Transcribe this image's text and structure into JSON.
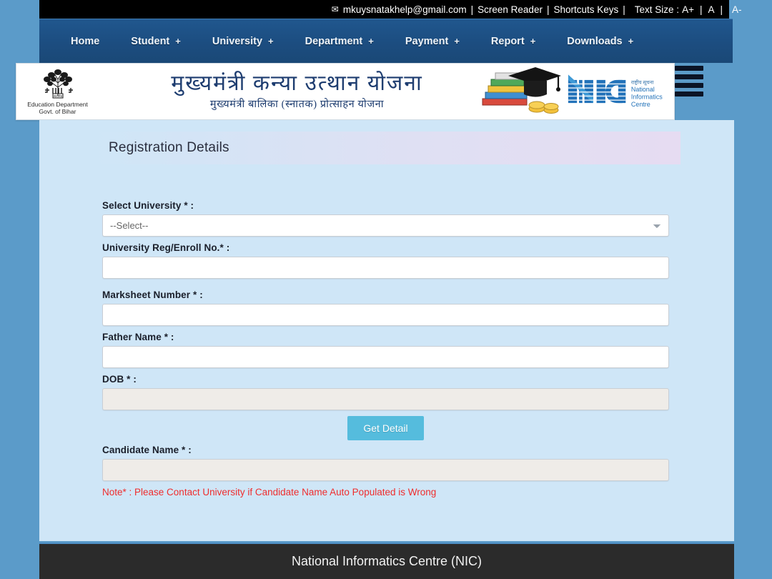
{
  "topbar": {
    "mail_icon": "envelope-icon",
    "email": "mkuysnatakhelp@gmail.com",
    "sep1": "|",
    "screen_reader": "Screen Reader",
    "sep2": "|",
    "shortcuts": "Shortcuts Keys",
    "sep3": "|",
    "text_size_label": "Text Size :",
    "a_plus": "A+",
    "sep4": "|",
    "a_normal": "A",
    "sep5": "|",
    "a_minus": "A-"
  },
  "nav": {
    "items": [
      {
        "label": "Home",
        "plus": ""
      },
      {
        "label": "Student",
        "plus": "+"
      },
      {
        "label": "University",
        "plus": "+"
      },
      {
        "label": "Department",
        "plus": "+"
      },
      {
        "label": "Payment",
        "plus": "+"
      },
      {
        "label": "Report",
        "plus": "+"
      },
      {
        "label": "Downloads",
        "plus": "+"
      }
    ]
  },
  "banner": {
    "emblem_line1": "Education Department",
    "emblem_line2": "Govt. of Bihar",
    "title_hi": "मुख्यमंत्री कन्या उत्थान योजना",
    "subtitle_hi": "मुख्यमंत्री बालिका (स्नातक) प्रोत्साहन योजना",
    "nic_abbr": "NIC",
    "nic_hi": "राष्ट्रीय सूचना विज्ञान केन्द्र",
    "nic_l1": "National",
    "nic_l2": "Informatics",
    "nic_l3": "Centre",
    "menu_icon": "hamburger-menu-icon"
  },
  "panel": {
    "title": "Registration Details"
  },
  "form": {
    "university": {
      "label": "Select University * :",
      "selected": "--Select--",
      "options": [
        "--Select--"
      ]
    },
    "reg_no": {
      "label": "University Reg/Enroll No.* :",
      "value": "",
      "placeholder": ""
    },
    "marksheet": {
      "label": "Marksheet Number * :",
      "value": "",
      "placeholder": ""
    },
    "father_name": {
      "label": "Father Name * :",
      "value": "",
      "placeholder": ""
    },
    "dob": {
      "label": "DOB * :",
      "value": "",
      "placeholder": ""
    },
    "get_detail_button": "Get Detail",
    "candidate_name": {
      "label": "Candidate Name * :",
      "value": "",
      "placeholder": ""
    },
    "note": "Note* : Please Contact University if Candidate Name Auto Populated is Wrong"
  },
  "footer": {
    "text": "National Informatics Centre (NIC)"
  },
  "colors": {
    "page_bg": "#5b9bc9",
    "nav_bg": "#1c4d80",
    "content_bg": "#cfe6f7",
    "button": "#55bcdd",
    "note_red": "#ef2d2d",
    "footer_bg": "#2b2b2b"
  }
}
